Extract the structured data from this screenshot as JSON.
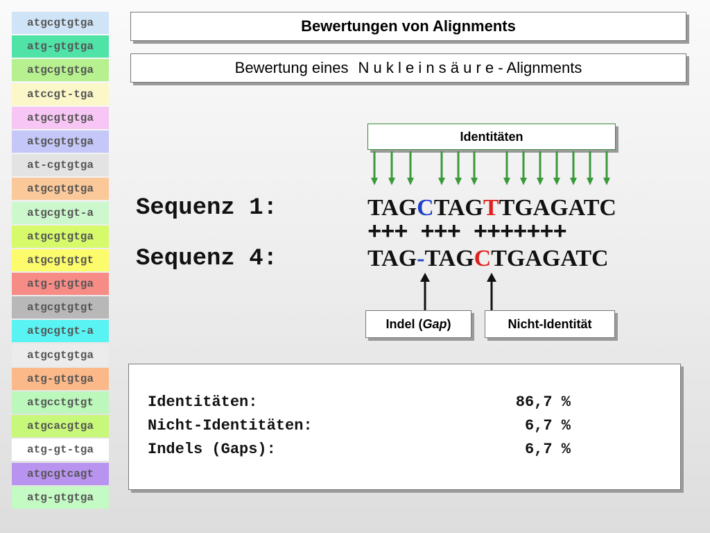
{
  "sidebar": {
    "items": [
      {
        "text": "atgcgtgtga",
        "bg": "#cfe4f7"
      },
      {
        "text": "atg-gtgtga",
        "bg": "#4fe3a8"
      },
      {
        "text": "atgcgtgtga",
        "bg": "#b6f08f"
      },
      {
        "text": "atccgt-tga",
        "bg": "#fbf7c9"
      },
      {
        "text": "atgcgtgtga",
        "bg": "#f7c6f4"
      },
      {
        "text": "atgcgtgtga",
        "bg": "#c4c7f7"
      },
      {
        "text": "at-cgtgtga",
        "bg": "#e3e3e3"
      },
      {
        "text": "atgcgtgtga",
        "bg": "#fbc899"
      },
      {
        "text": "atgcgtgt-a",
        "bg": "#cdf7cd"
      },
      {
        "text": "atgcgtgtga",
        "bg": "#d6fa6a"
      },
      {
        "text": "atgcgtgtgt",
        "bg": "#fbfb6b"
      },
      {
        "text": "atg-gtgtga",
        "bg": "#f78b86"
      },
      {
        "text": "atgcgtgtgt",
        "bg": "#b8b8b8"
      },
      {
        "text": "atgcgtgt-a",
        "bg": "#59f3f3"
      },
      {
        "text": "atgcgtgtga",
        "bg": "#ececec"
      },
      {
        "text": "atg-gtgtga",
        "bg": "#fbb889"
      },
      {
        "text": "atgcctgtgt",
        "bg": "#bcf7bc"
      },
      {
        "text": "atgcacgtga",
        "bg": "#c8f87a"
      },
      {
        "text": "atg-gt-tga",
        "bg": "#ffffff"
      },
      {
        "text": "atgcgtcagt",
        "bg": "#b993f0"
      },
      {
        "text": "atg-gtgtga",
        "bg": "#c4fac4"
      }
    ]
  },
  "title": "Bewertungen von Alignments",
  "subtitle": {
    "part1": "Bewertung eines",
    "spaced": "N u k l e i n s ä u r e",
    "part2": "- Alignments"
  },
  "identity_label": "Identitäten",
  "seq1": {
    "label": "Sequenz 1:",
    "a": "TAG",
    "b": "C",
    "c": "TAG",
    "d": "T",
    "e": "TGAGATC"
  },
  "match_line": "+++ +++ +++++++",
  "seq4": {
    "label": "Sequenz 4:",
    "a": "TAG",
    "b": "-",
    "c": "TAG",
    "d": "C",
    "e": "TGAGATC"
  },
  "indel": {
    "prefix": "Indel (",
    "italic": "Gap",
    "suffix": ")"
  },
  "nonidentity_label": "Nicht-Identität",
  "stats": [
    {
      "label": "Identitäten:",
      "value": "86,7 %"
    },
    {
      "label": "Nicht-Identitäten:",
      "value": "6,7 %"
    },
    {
      "label": "Indels (Gaps):",
      "value": "6,7 %"
    }
  ],
  "colors": {
    "gap": "#1f3fc8",
    "mismatch": "#e0201e",
    "identity_arrow": "#3a9a3a"
  }
}
